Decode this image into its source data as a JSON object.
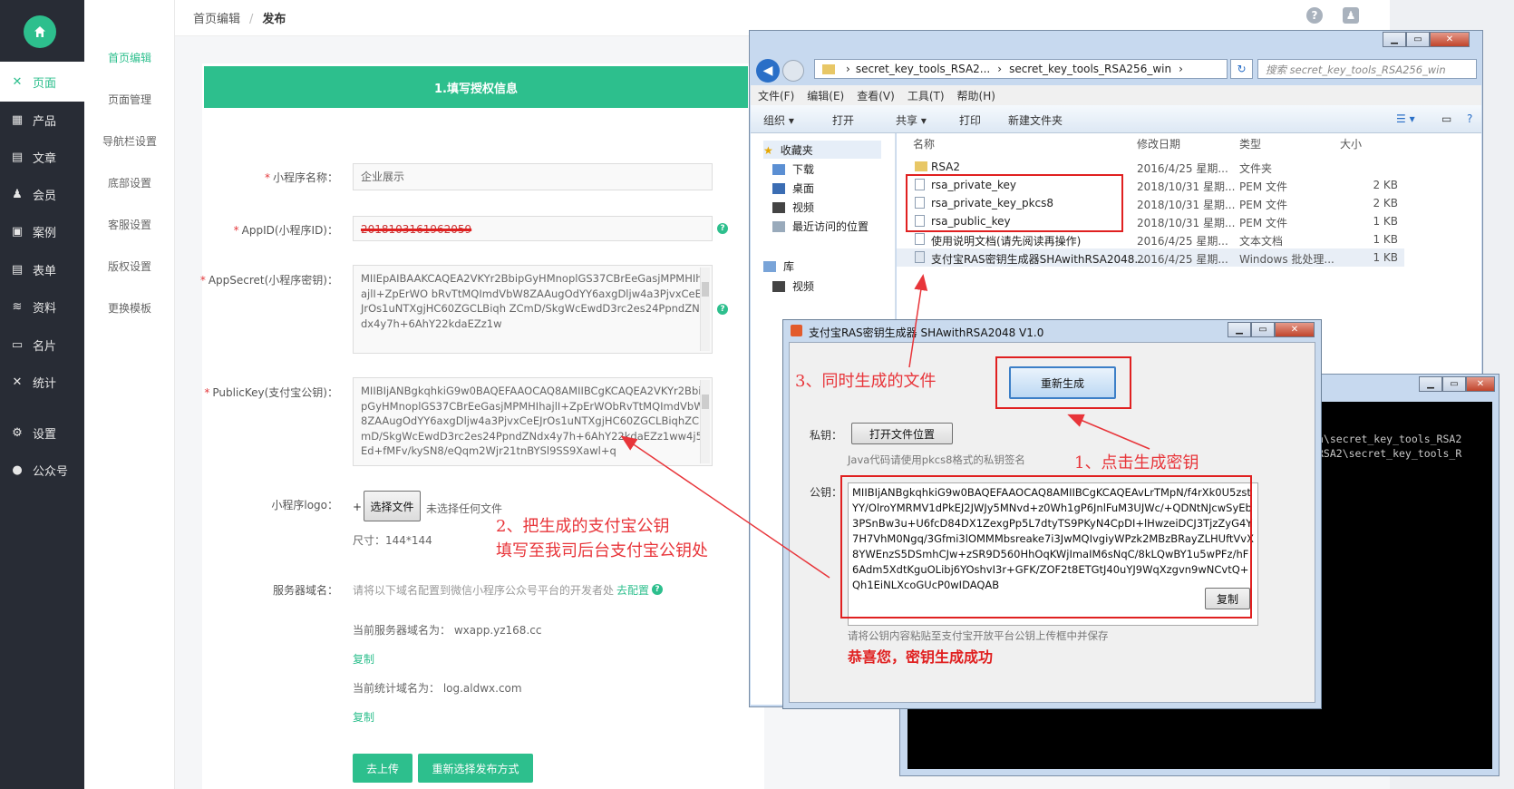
{
  "colors": {
    "accent": "#2dbf8d",
    "annotation": "#e8353a",
    "nav_bg": "#282c35"
  },
  "left_nav": {
    "home_icon": "home-icon",
    "items": [
      {
        "label": "页面",
        "icon": "tools-icon",
        "active": true
      },
      {
        "label": "产品",
        "icon": "grid-icon"
      },
      {
        "label": "文章",
        "icon": "document-icon"
      },
      {
        "label": "会员",
        "icon": "user-icon"
      },
      {
        "label": "案例",
        "icon": "case-icon"
      },
      {
        "label": "表单",
        "icon": "form-icon"
      },
      {
        "label": "资料",
        "icon": "layers-icon"
      },
      {
        "label": "名片",
        "icon": "card-icon"
      },
      {
        "label": "统计",
        "icon": "chart-icon"
      },
      {
        "label": "设置",
        "icon": "gear-icon"
      },
      {
        "label": "公众号",
        "icon": "wechat-icon"
      }
    ]
  },
  "sub_nav": {
    "items": [
      "首页编辑",
      "页面管理",
      "导航栏设置",
      "底部设置",
      "客服设置",
      "版权设置",
      "更换模板"
    ]
  },
  "breadcrumb": {
    "first": "首页编辑",
    "sep": "/",
    "current": "发布"
  },
  "form": {
    "step_title": "1.填写授权信息",
    "name_label": "小程序名称：",
    "name_value": "企业展示",
    "appid_label": "AppID(小程序ID)：",
    "appid_value": "2018103161962059",
    "secret_label": "AppSecret(小程序密钥)：",
    "secret_value": "MIIEpAIBAAKCAQEA2VKYr2BbipGyHMnoplGS37CBrEeGasjMPMHIhajlI+ZpErWO bRvTtMQImdVbW8ZAAugOdYY6axgDljw4a3PjvxCeEJrOs1uNTXgjHC60ZGCLBiqh ZCmD/SkgWcEwdD3rc2es24PpndZNdx4y7h+6AhY22kdaEZz1w",
    "publickey_label": "PublicKey(支付宝公钥)：",
    "publickey_value": "MIIBIjANBgkqhkiG9w0BAQEFAAOCAQ8AMIIBCgKCAQEA2VKYr2BbipGyHMnoplGS37CBrEeGasjMPMHIhajlI+ZpErWObRvTtMQImdVbW8ZAAugOdYY6axgDljw4a3PjvxCeEJrOs1uNTXgjHC60ZGCLBiqhZCmD/SkgWcEwdD3rc2es24PpndZNdx4y7h+6AhY22kdaEZz1ww4j5Ed+fMFv/kySN8/eQqm2Wjr21tnBYSl9SS9Xawl+q",
    "logo_label": "小程序logo：",
    "logo_plus": "+",
    "logo_button": "选择文件",
    "logo_status": "未选择任何文件",
    "logo_size": "尺寸：144*144",
    "domain_label": "服务器域名：",
    "domain_hint": "请将以下域名配置到微信小程序公众号平台的开发者处",
    "domain_link": "去配置",
    "server_domain": "当前服务器域名为： wxapp.yz168.cc",
    "copy1": "复制",
    "stat_domain": "当前统计域名为： log.aldwx.com",
    "copy2": "复制",
    "upload_button": "去上传",
    "reselect_button": "重新选择发布方式"
  },
  "explorer": {
    "addr_part1": "secret_key_tools_RSA2...",
    "addr_part2": "secret_key_tools_RSA256_win",
    "search_placeholder": "搜索 secret_key_tools_RSA256_win",
    "menus": [
      "文件(F)",
      "编辑(E)",
      "查看(V)",
      "工具(T)",
      "帮助(H)"
    ],
    "toolbar": {
      "organize": "组织 ▾",
      "open": "打开",
      "share": "共享 ▾",
      "print": "打印",
      "new_folder": "新建文件夹"
    },
    "nav": [
      "收藏夹",
      "下载",
      "桌面",
      "视频",
      "最近访问的位置",
      "库",
      "视频"
    ],
    "columns": {
      "name": "名称",
      "date": "修改日期",
      "type": "类型",
      "size": "大小"
    },
    "files": [
      {
        "name": "RSA2",
        "date": "2016/4/25 星期...",
        "type": "文件夹",
        "size": ""
      },
      {
        "name": "rsa_private_key",
        "date": "2018/10/31 星期...",
        "type": "PEM 文件",
        "size": "2 KB"
      },
      {
        "name": "rsa_private_key_pkcs8",
        "date": "2018/10/31 星期...",
        "type": "PEM 文件",
        "size": "2 KB"
      },
      {
        "name": "rsa_public_key",
        "date": "2018/10/31 星期...",
        "type": "PEM 文件",
        "size": "1 KB"
      },
      {
        "name": "使用说明文档(请先阅读再操作)",
        "date": "2016/4/25 星期...",
        "type": "文本文档",
        "size": "1 KB"
      },
      {
        "name": "支付宝RAS密钥生成器SHAwithRSA2048...",
        "date": "2016/4/25 星期...",
        "type": "Windows 批处理...",
        "size": "1 KB"
      }
    ]
  },
  "dialog": {
    "title": "支付宝RAS密钥生成器 SHAwithRSA2048 V1.0",
    "regen_button": "重新生成",
    "private_label": "私钥：",
    "open_folder_button": "打开文件位置",
    "java_hint": "Java代码请使用pkcs8格式的私钥签名",
    "public_label": "公钥：",
    "public_key": "MIIBIjANBgkqhkiG9w0BAQEFAAOCAQ8AMIIBCgKCAQEAvLrTMpN/f4rXk0U5zstYY/OlroYMRMV1dPkEJ2JWJy5MNvd+z0Wh1gP6JnlFuM3UJWc/+QDNtNJcwSyEb3PSnBw3u+U6fcD84DX1ZexgPp5L7dtyTS9PKyN4CpDI+lHwzeiDCJ3TjzZyG4Y7H7VhM0Ngq/3Gfmi3lOMMMbsreake7i3JwMQIvgiyWPzk2MBzBRayZLHUftVvX8YWEnzS5DSmhCJw+zSR9D560HhOqKWjImaIM6sNqC/8kLQwBY1u5wPFz/hF6Adm5XdtKguOLibj6YOshvI3r+GFK/ZOF2t8ETGtJ40uYJ9WqXzgvn9wNCvtQ+Qh1EiNLXcoGUcP0wIDAQAB",
    "copy_button": "复制",
    "paste_hint": "请将公钥内容粘贴至支付宝开放平台公钥上传框中并保存",
    "success": "恭喜您，密钥生成成功"
  },
  "console": {
    "line1": "n\\secret_key_tools_RSA2",
    "line2": "RSA2\\secret_key_tools_R"
  },
  "annotations": {
    "a1": "1、点击生成密钥",
    "a2_line1": "2、把生成的支付宝公钥",
    "a2_line2": "填写至我司后台支付宝公钥处",
    "a3": "3、同时生成的文件"
  },
  "header_icons": [
    "help-icon",
    "avatar-icon"
  ]
}
